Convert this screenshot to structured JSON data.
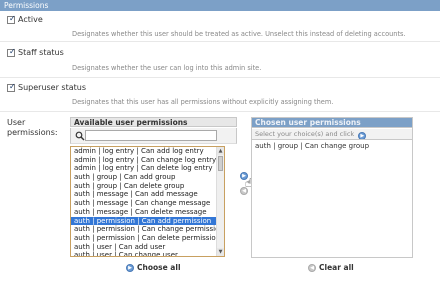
{
  "section": {
    "title": "Permissions"
  },
  "fields": [
    {
      "label": "Active",
      "checked": true,
      "help": "Designates whether this user should be treated as active. Unselect this instead of deleting accounts."
    },
    {
      "label": "Staff status",
      "checked": true,
      "help": "Designates whether the user can log into this admin site."
    },
    {
      "label": "Superuser status",
      "checked": true,
      "help": "Designates that this user has all permissions without explicitly assigning them."
    }
  ],
  "user_permissions": {
    "label": "User permissions:",
    "available_title": "Available user permissions",
    "filter_value": "",
    "available": [
      "admin | log entry | Can add log entry",
      "admin | log entry | Can change log entry",
      "admin | log entry | Can delete log entry",
      "auth | group | Can add group",
      "auth | group | Can delete group",
      "auth | message | Can add message",
      "auth | message | Can change message",
      "auth | message | Can delete message",
      "auth | permission | Can add permission",
      "auth | permission | Can change permission",
      "auth | permission | Can delete permission",
      "auth | user | Can add user",
      "auth | user | Can change user"
    ],
    "selected_index": 8,
    "chosen_title": "Chosen user permissions",
    "chosen_help": "Select your choice(s) and click",
    "chosen": [
      "auth | group | Can change group"
    ],
    "choose_all": "Choose all",
    "clear_all": "Clear all"
  },
  "colors": {
    "header": "#7ca0c7",
    "selected": "#3377d6"
  }
}
